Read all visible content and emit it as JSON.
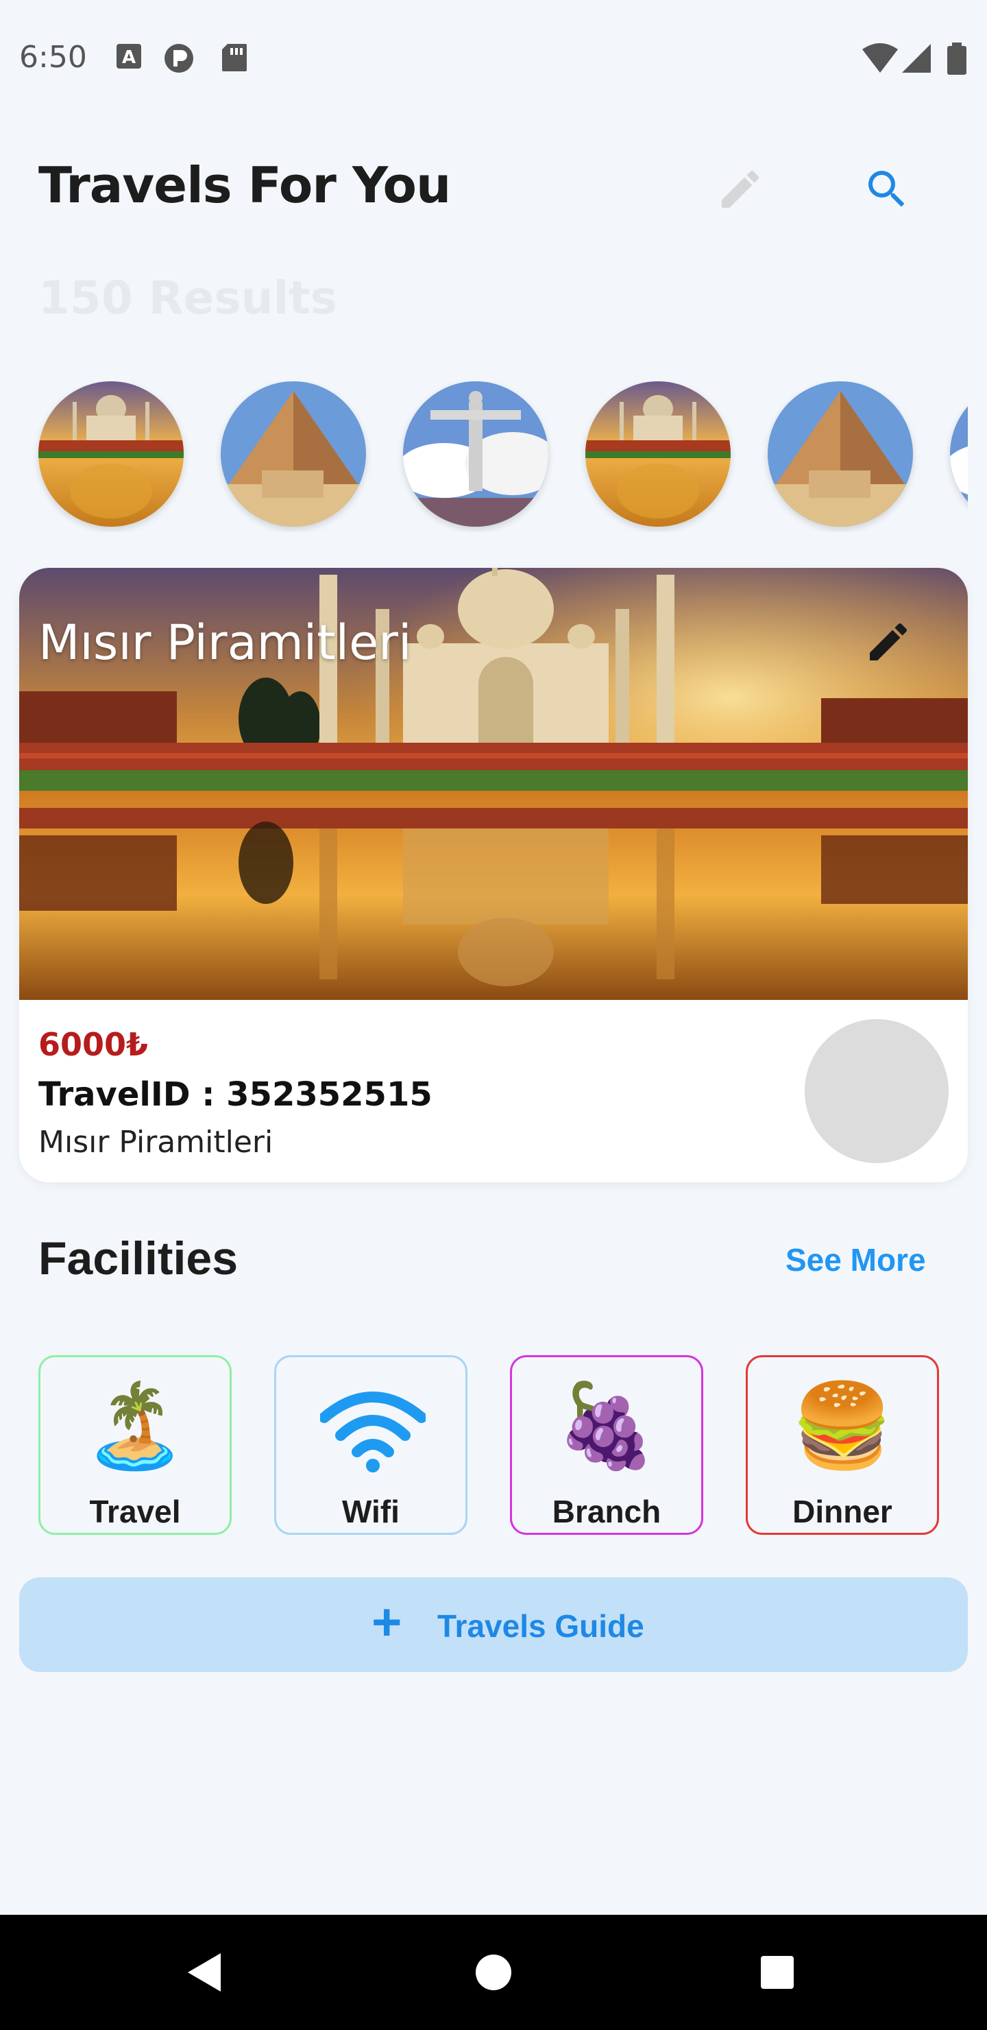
{
  "status": {
    "time": "6:50"
  },
  "header": {
    "title": "Travels For You"
  },
  "results": "150 Results",
  "card": {
    "title": "Mısır Piramitleri",
    "price": "6000₺",
    "travel_id": "TravelID : 352352515",
    "name": "Mısır Piramitleri"
  },
  "facilities": {
    "title": "Facilities",
    "see_more": "See More",
    "items": [
      {
        "label": "Travel",
        "emoji": "🏝️",
        "border": "#8ef0a3"
      },
      {
        "label": "Wifi",
        "emoji": "📶",
        "border": "#a9d4f5"
      },
      {
        "label": "Branch",
        "emoji": "🍇",
        "border": "#d633e0"
      },
      {
        "label": "Dinner",
        "emoji": "🍔",
        "border": "#e53935"
      }
    ]
  },
  "guide": {
    "plus": "+",
    "label": "Travels Guide"
  },
  "colors": {
    "accent": "#2196f3",
    "price": "#b71c1c",
    "background": "#f3f7fb"
  },
  "icons": [
    "edit-icon",
    "search-icon",
    "back-icon",
    "home-icon",
    "recents-icon"
  ]
}
